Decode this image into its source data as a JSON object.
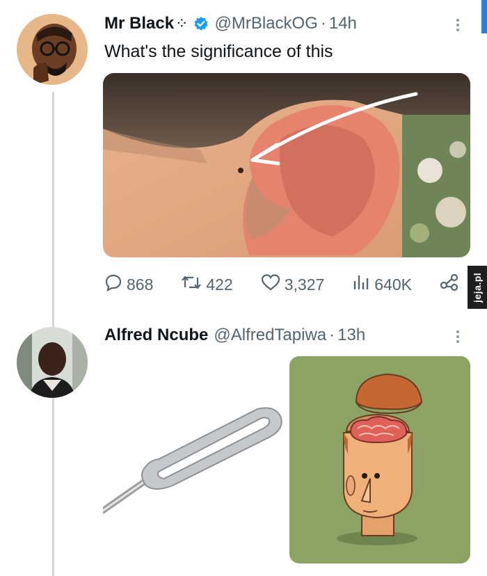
{
  "tweets": [
    {
      "display_name": "Mr Black",
      "handle": "@MrBlackOG",
      "time": "14h",
      "text": "What's the significance of this",
      "verified": true,
      "stats": {
        "replies": "868",
        "retweets": "422",
        "likes": "3,327",
        "views": "640K"
      }
    },
    {
      "display_name": "Alfred Ncube",
      "handle": "@AlfredTapiwa",
      "time": "13h"
    }
  ],
  "watermark": "jeja.pl",
  "icons": {
    "reply": "comment-icon",
    "retweet": "retweet-icon",
    "like": "heart-icon",
    "views": "views-icon",
    "share": "share-icon",
    "more": "more-icon",
    "verified": "verified-badge-icon"
  },
  "colors": {
    "verified": "#1d9bf0",
    "secondary_text": "#536471",
    "thread_line": "#cfd9de"
  }
}
